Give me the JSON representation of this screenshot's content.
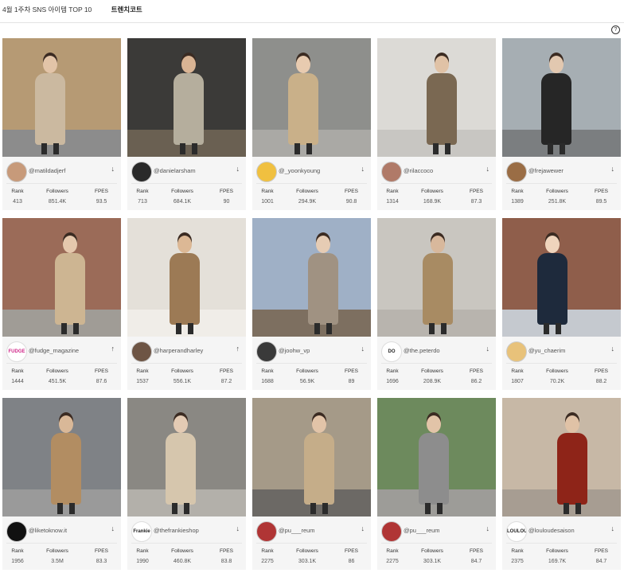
{
  "header": {
    "title": "4월 1주차 SNS 아이템 TOP 10",
    "tab": "트렌치코트"
  },
  "help_icon": "question-circle-icon",
  "stat_labels": {
    "rank": "Rank",
    "followers": "Followers",
    "fpes": "FPES"
  },
  "cards": [
    {
      "handle": "@matildadjerf",
      "rank": "413",
      "followers": "851.4K",
      "fpes": "93.5",
      "trend": "↓",
      "avatar_text": "",
      "palette": {
        "bg": "#b69a74",
        "coat": "#cbb9a0",
        "skin": "#e2c4a8",
        "ground": "#8c8c8c",
        "av": "#c79a7a"
      }
    },
    {
      "handle": "@danielarsham",
      "rank": "713",
      "followers": "684.1K",
      "fpes": "90",
      "trend": "↓",
      "avatar_text": "",
      "palette": {
        "bg": "#3b3a38",
        "coat": "#b5ae9d",
        "skin": "#d9b494",
        "ground": "#6a6052",
        "av": "#2a2a2a"
      }
    },
    {
      "handle": "@_yoonkyoung",
      "rank": "1001",
      "followers": "294.9K",
      "fpes": "90.8",
      "trend": "↓",
      "avatar_text": "",
      "palette": {
        "bg": "#8e8f8c",
        "coat": "#c9b089",
        "skin": "#e8cbb0",
        "ground": "#aaa9a5",
        "av": "#f0c040"
      }
    },
    {
      "handle": "@rilaccoco",
      "rank": "1314",
      "followers": "168.9K",
      "fpes": "87.3",
      "trend": "↓",
      "avatar_text": "",
      "palette": {
        "bg": "#dcdad6",
        "coat": "#7a6852",
        "skin": "#e0c2a6",
        "ground": "#c8c6c2",
        "av": "#b07a68"
      }
    },
    {
      "handle": "@frejawewer",
      "rank": "1389",
      "followers": "251.8K",
      "fpes": "89.5",
      "trend": "↓",
      "avatar_text": "",
      "palette": {
        "bg": "#a6aeb3",
        "coat": "#262626",
        "skin": "#e2c8b0",
        "ground": "#7b7e80",
        "av": "#9a6d45"
      }
    },
    {
      "handle": "@fudge_magazine",
      "rank": "1444",
      "followers": "451.5K",
      "fpes": "87.6",
      "trend": "↑",
      "avatar_text": "FUDGE",
      "palette": {
        "bg": "#9b6b58",
        "coat": "#cdb592",
        "skin": "#e5c8ad",
        "ground": "#a09c96",
        "av": "#ffffff"
      }
    },
    {
      "handle": "@harperandharley",
      "rank": "1537",
      "followers": "556.1K",
      "fpes": "87.2",
      "trend": "↑",
      "avatar_text": "",
      "palette": {
        "bg": "#e4e0d9",
        "coat": "#9c7a55",
        "skin": "#dcb895",
        "ground": "#f0ede8",
        "av": "#6e5545"
      }
    },
    {
      "handle": "@joohw_vp",
      "rank": "1688",
      "followers": "56.9K",
      "fpes": "89",
      "trend": "↓",
      "avatar_text": "",
      "palette": {
        "bg": "#9fb0c6",
        "coat": "#a09282",
        "skin": "#e6ccb4",
        "ground": "#7d6f60",
        "av": "#3a3a3a"
      }
    },
    {
      "handle": "@the.peterdo",
      "rank": "1696",
      "followers": "208.9K",
      "fpes": "86.2",
      "trend": "↓",
      "avatar_text": "DO",
      "palette": {
        "bg": "#c9c6c0",
        "coat": "#a88b63",
        "skin": "#d8b89c",
        "ground": "#b8b4ae",
        "av": "#ffffff"
      }
    },
    {
      "handle": "@yu_chaerim",
      "rank": "1807",
      "followers": "70.2K",
      "fpes": "88.2",
      "trend": "↓",
      "avatar_text": "",
      "palette": {
        "bg": "#8f5e4b",
        "coat": "#1e2a3c",
        "skin": "#efd4bc",
        "ground": "#c5c9cf",
        "av": "#e8c27a"
      }
    },
    {
      "handle": "@liketoknow.it",
      "rank": "1956",
      "followers": "3.5M",
      "fpes": "83.3",
      "trend": "↓",
      "avatar_text": "",
      "palette": {
        "bg": "#7f8286",
        "coat": "#b28d62",
        "skin": "#d9b898",
        "ground": "#9a9a9a",
        "av": "#111111"
      }
    },
    {
      "handle": "@thefrankieshop",
      "rank": "1990",
      "followers": "460.8K",
      "fpes": "83.8",
      "trend": "↓",
      "avatar_text": "Frankie",
      "palette": {
        "bg": "#8a8883",
        "coat": "#d6c6ad",
        "skin": "#e4cbb4",
        "ground": "#b3b0aa",
        "av": "#ffffff"
      }
    },
    {
      "handle": "@pu___reum",
      "rank": "2275",
      "followers": "303.1K",
      "fpes": "86",
      "trend": "↓",
      "avatar_text": "",
      "palette": {
        "bg": "#a59a88",
        "coat": "#c5ad89",
        "skin": "#e2c4a8",
        "ground": "#6c6965",
        "av": "#b03535"
      }
    },
    {
      "handle": "@pu___reum",
      "rank": "2275",
      "followers": "303.1K",
      "fpes": "84.7",
      "trend": "↓",
      "avatar_text": "",
      "palette": {
        "bg": "#6d8a5d",
        "coat": "#8d8d8d",
        "skin": "#e2c4a8",
        "ground": "#9d9c98",
        "av": "#b03535"
      }
    },
    {
      "handle": "@louloudesaison",
      "rank": "2375",
      "followers": "169.7K",
      "fpes": "84.7",
      "trend": "↓",
      "avatar_text": "LOULOU",
      "palette": {
        "bg": "#c7b8a6",
        "coat": "#8e2418",
        "skin": "#e0c2a6",
        "ground": "#a79d92",
        "av": "#ffffff"
      }
    }
  ]
}
